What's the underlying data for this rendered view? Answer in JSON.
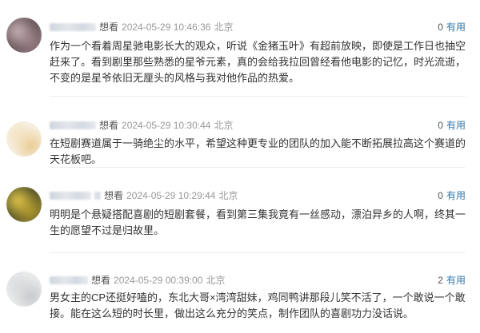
{
  "comments": [
    {
      "username_masked": "",
      "action": "想看",
      "time": "2024-05-29 10:46:36",
      "location": "北京",
      "useful_count": "0",
      "useful_label": "有用",
      "text": "作为一个看着周星驰电影长大的观众，听说《金猪玉叶》有超前放映，即使是工作日也抽空赶来了。看到剧里那些熟悉的星爷元素，真的会给我拉回曾经看他电影的记忆，时光流逝，不变的是星爷依旧无厘头的风格与我对他作品的热爱。",
      "avatar_colors": [
        "#c9b3b8",
        "#9a7f86",
        "#6b5a5e"
      ]
    },
    {
      "username_masked": "",
      "action": "想看",
      "time": "2024-05-29 10:30:44",
      "location": "北京",
      "useful_count": "0",
      "useful_label": "有用",
      "text": "在短剧赛道属于一骑绝尘的水平，希望这种更专业的团队的加入能不断拓展拉高这个赛道的天花板吧。",
      "avatar_colors": [
        "#f3e2c0",
        "#e8c88a",
        "#f7f1e6"
      ]
    },
    {
      "username_masked": "",
      "action": "想看",
      "time": "2024-05-29 10:29:44",
      "location": "北京",
      "useful_count": "0",
      "useful_label": "有用",
      "text": "明明是个悬疑搭配喜剧的短剧套餐，看到第三集我竟有一丝感动，漂泊异乡的人啊，终其一生的愿望不过是归故里。",
      "avatar_colors": [
        "#e6c94a",
        "#b49a2c",
        "#5b5a2a"
      ]
    },
    {
      "username_masked": "",
      "action": "想看",
      "time": "2024-05-29 00:39:00",
      "location": "北京",
      "useful_count": "2",
      "useful_label": "有用",
      "text": "男女主的CP还挺好嗑的，东北大哥×湾湾甜妹，鸡同鸭讲那段儿笑不活了，一个敢说一个敢接。能在这么短的时长里，做出这么充分的笑点，制作团队的喜剧功力没话说。",
      "avatar_colors": [
        "#d9dadc",
        "#c3c6ca",
        "#eceded"
      ]
    }
  ]
}
